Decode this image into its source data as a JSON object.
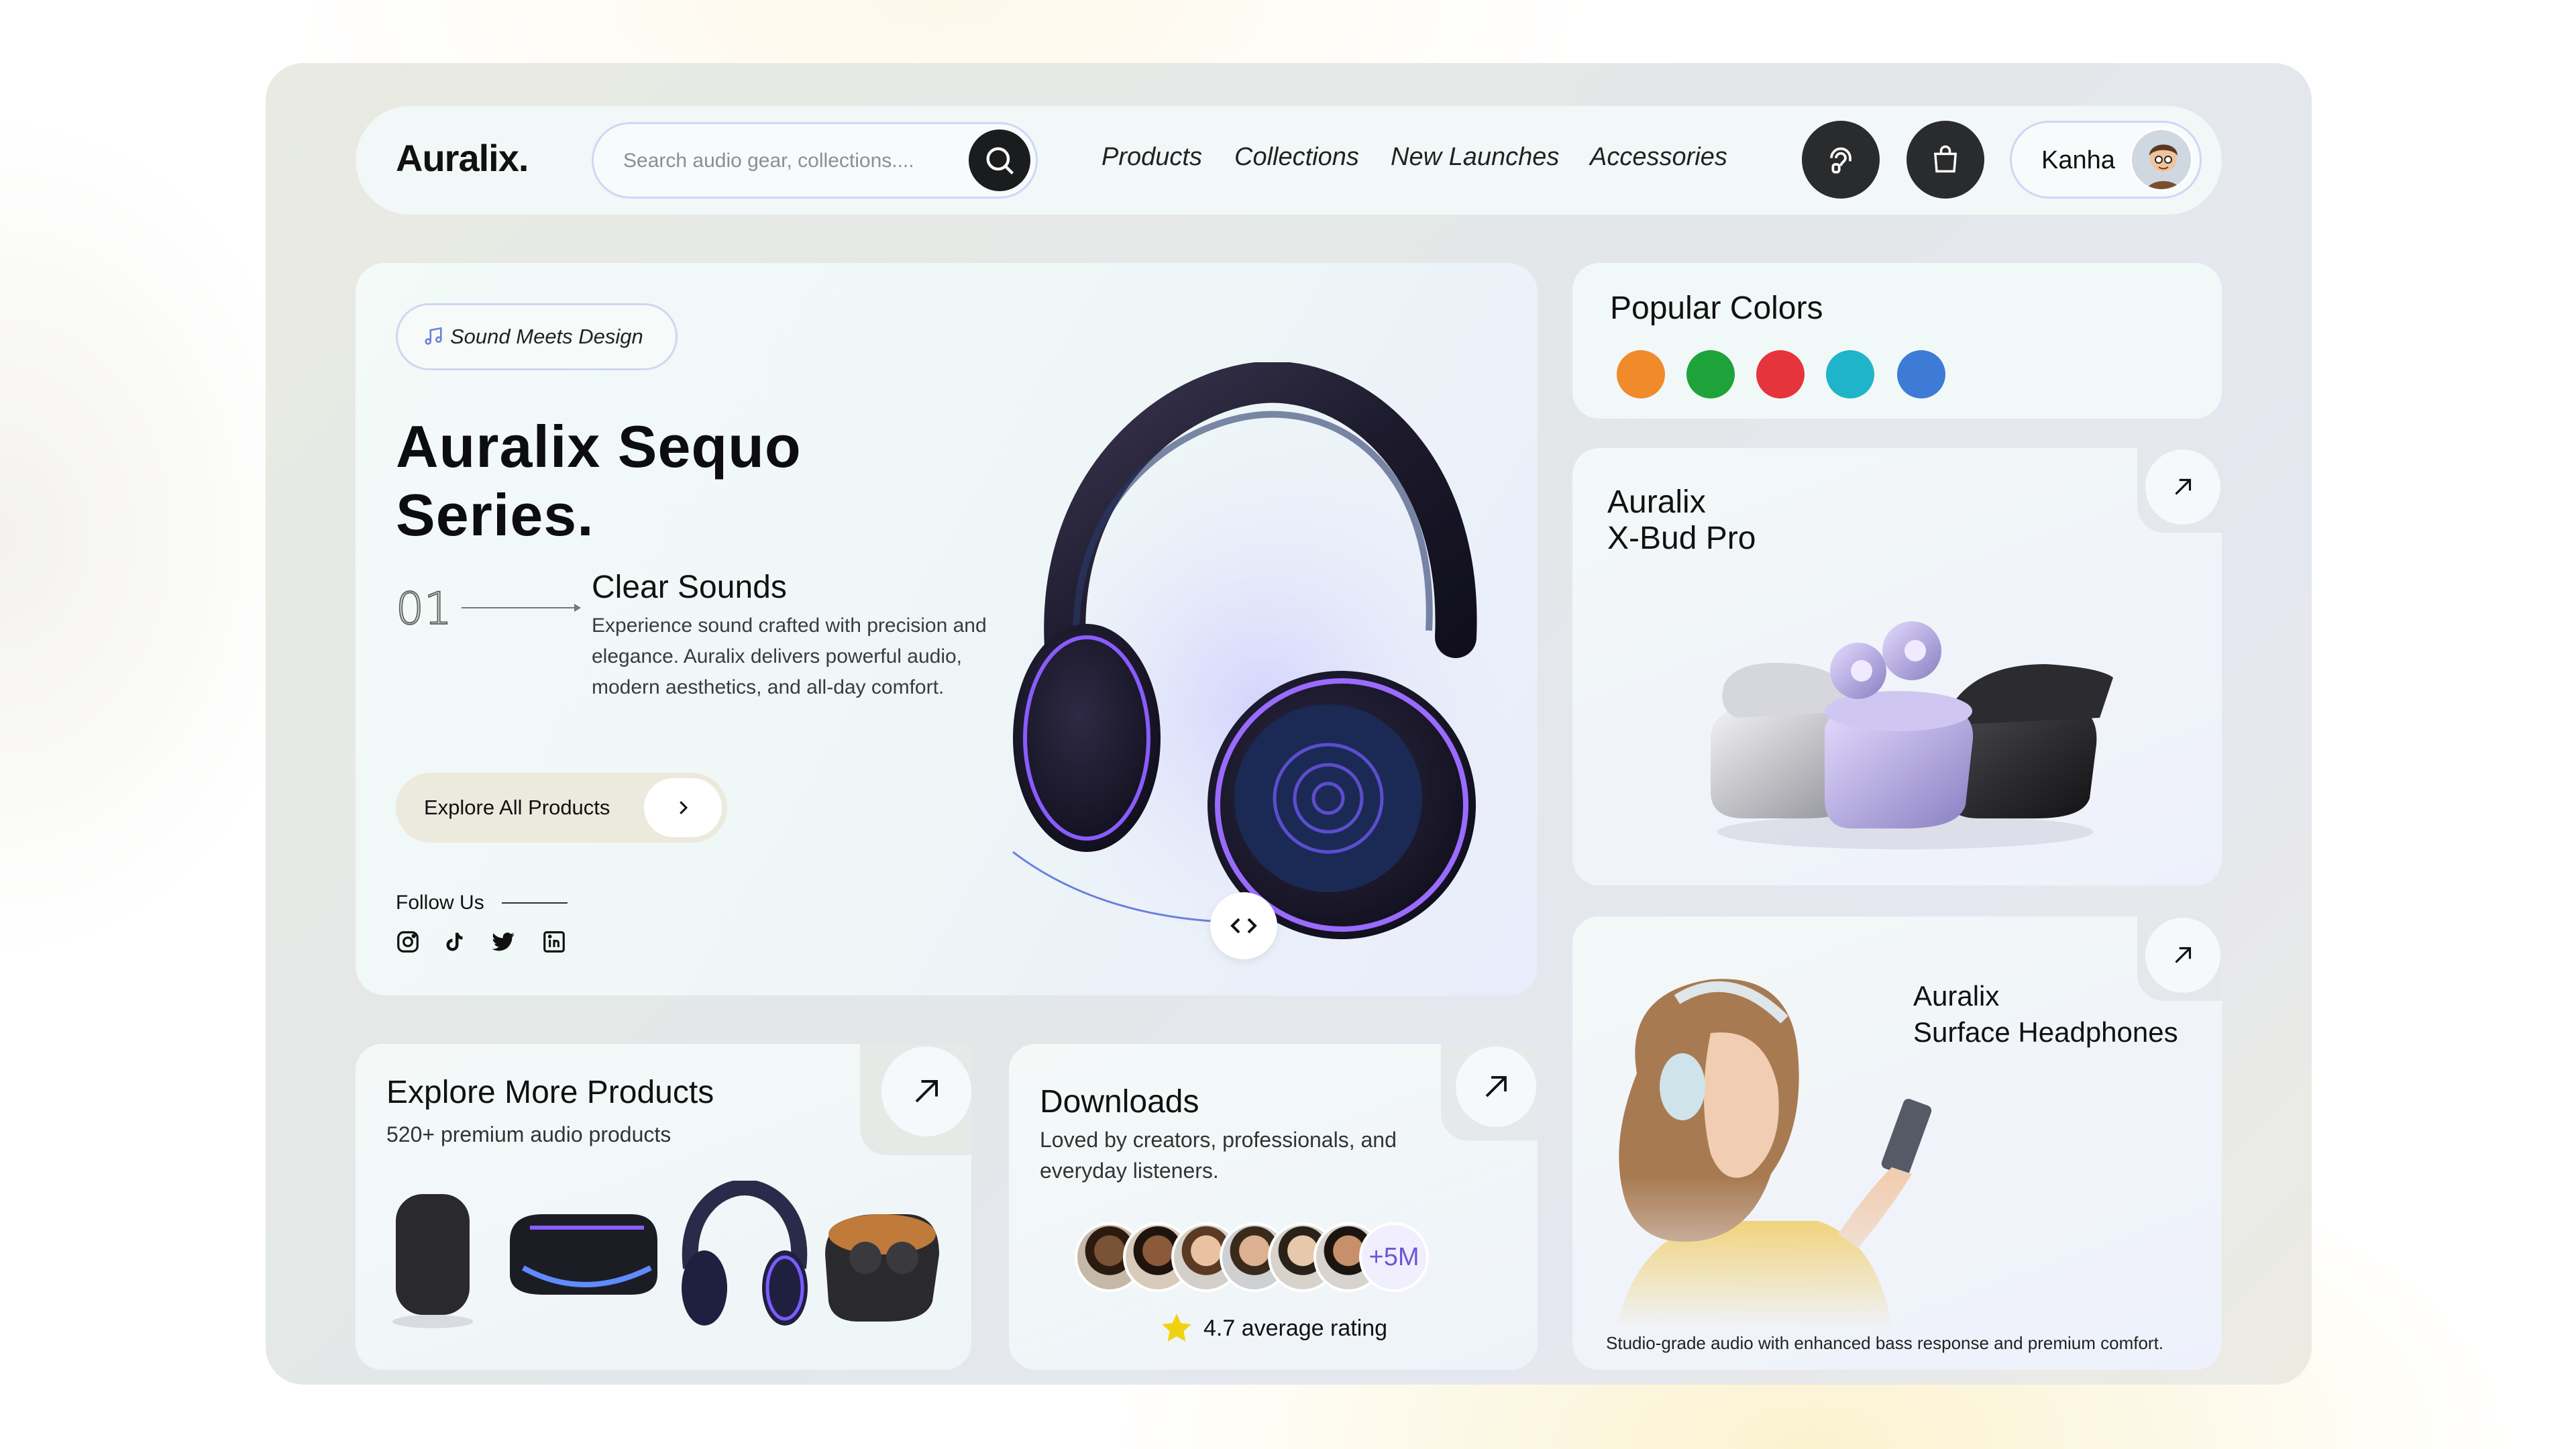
{
  "brand": {
    "logo": "Auralix."
  },
  "search": {
    "placeholder": "Search audio gear, collections...."
  },
  "nav": {
    "menu": [
      "Products",
      "Collections",
      "New Launches",
      "Accessories"
    ],
    "user_name": "Kanha"
  },
  "hero": {
    "tagline": "Sound Meets Design",
    "title": "Auralix Sequo Series.",
    "feature_number": "01",
    "feature_title": "Clear Sounds",
    "feature_desc": "Experience sound crafted with precision and elegance. Auralix delivers powerful audio, modern aesthetics, and all-day comfort.",
    "cta": "Explore All Products",
    "follow": "Follow Us",
    "social_icons": [
      "instagram-icon",
      "tiktok-icon",
      "twitter-icon",
      "linkedin-icon"
    ]
  },
  "colors": {
    "title": "Popular Colors",
    "swatches": [
      "#f08a2a",
      "#1ea33a",
      "#e6343c",
      "#1fb4c9",
      "#3e7bd6"
    ]
  },
  "xbud": {
    "title_line1": "Auralix",
    "title_line2": "X-Bud Pro"
  },
  "surface": {
    "title_line1": "Auralix",
    "title_line2": "Surface Headphones",
    "caption": "Studio-grade audio with enhanced bass response and premium comfort."
  },
  "explore_more": {
    "title": "Explore More Products",
    "subtitle": "520+ premium audio products"
  },
  "downloads": {
    "title": "Downloads",
    "subtitle": "Loved by creators, professionals, and everyday listeners.",
    "count_badge": "+5M",
    "rating": "4.7 average rating"
  },
  "theme": {
    "accent": "#6b56d6",
    "dark": "#1b1c1e"
  }
}
